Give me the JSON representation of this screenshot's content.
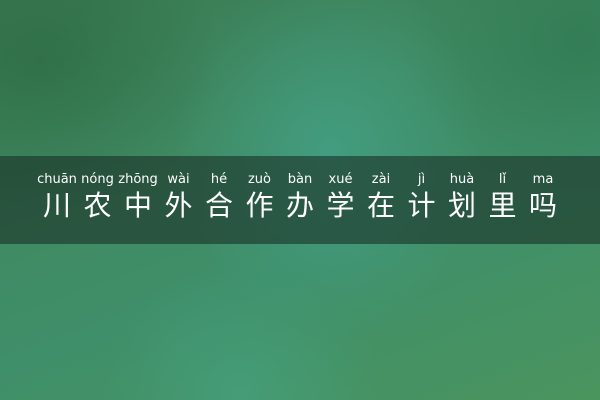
{
  "title": {
    "chars": [
      {
        "pinyin": "chuān",
        "hanzi": "川"
      },
      {
        "pinyin": "nóng",
        "hanzi": "农"
      },
      {
        "pinyin": "zhōng",
        "hanzi": "中"
      },
      {
        "pinyin": "wài",
        "hanzi": "外"
      },
      {
        "pinyin": "hé",
        "hanzi": "合"
      },
      {
        "pinyin": "zuò",
        "hanzi": "作"
      },
      {
        "pinyin": "bàn",
        "hanzi": "办"
      },
      {
        "pinyin": "xué",
        "hanzi": "学"
      },
      {
        "pinyin": "zài",
        "hanzi": "在"
      },
      {
        "pinyin": "jì",
        "hanzi": "计"
      },
      {
        "pinyin": "huà",
        "hanzi": "划"
      },
      {
        "pinyin": "lǐ",
        "hanzi": "里"
      },
      {
        "pinyin": "ma",
        "hanzi": "吗"
      }
    ]
  },
  "colors": {
    "text": "#ffffff",
    "band": "#1c3228",
    "background": "#3f8a62"
  }
}
